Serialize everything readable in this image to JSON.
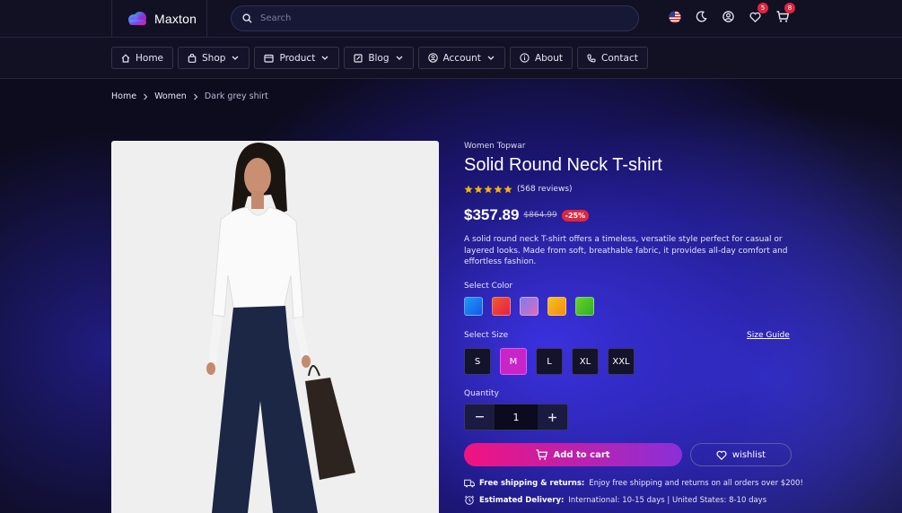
{
  "header": {
    "brand": "Maxton",
    "search_placeholder": "Search",
    "wishlist_count": "5",
    "cart_count": "8"
  },
  "nav": {
    "items": [
      {
        "label": "Home",
        "icon": "home-icon"
      },
      {
        "label": "Shop",
        "icon": "bag-icon",
        "dropdown": true
      },
      {
        "label": "Product",
        "icon": "store-icon",
        "dropdown": true
      },
      {
        "label": "Blog",
        "icon": "edit-icon",
        "dropdown": true
      },
      {
        "label": "Account",
        "icon": "user-circle-icon",
        "dropdown": true
      },
      {
        "label": "About",
        "icon": "info-icon"
      },
      {
        "label": "Contact",
        "icon": "phone-icon"
      }
    ]
  },
  "breadcrumb": [
    "Home",
    "Women",
    "Dark grey shirt"
  ],
  "product": {
    "category": "Women Topwar",
    "title": "Solid Round Neck T-shirt",
    "rating": 5,
    "reviews": "(568 reviews)",
    "price": "$357.89",
    "old_price": "$864.99",
    "discount": "-25%",
    "description": "A solid round neck T-shirt offers a timeless, versatile style perfect for casual or layered looks. Made from soft, breathable fabric, it provides all-day comfort and effortless fashion.",
    "color_label": "Select Color",
    "colors": [
      {
        "name": "blue",
        "value": "#1a7cf5"
      },
      {
        "name": "red",
        "value": "#f23b3b"
      },
      {
        "name": "purple-pink",
        "value": "#b46fd4"
      },
      {
        "name": "orange",
        "value": "#f7a21b"
      },
      {
        "name": "green",
        "value": "#4fc324"
      }
    ],
    "size_label": "Select Size",
    "size_guide": "Size Guide",
    "sizes": [
      "S",
      "M",
      "L",
      "XL",
      "XXL"
    ],
    "selected_size": "M",
    "quantity_label": "Quantity",
    "quantity": "1",
    "add_to_cart": "Add to cart",
    "wishlist": "wishlist",
    "shipping_title": "Free shipping & returns:",
    "shipping_text": "Enjoy free shipping and returns on all orders over $200!",
    "delivery_title": "Estimated Delivery:",
    "delivery_text": "International: 10-15 days | United States: 8-10 days"
  },
  "colors": {
    "accent_pink": "#f2137f",
    "accent_purple": "#8a2fd8",
    "badge_red": "#e0263e",
    "star": "#f5b50a"
  }
}
